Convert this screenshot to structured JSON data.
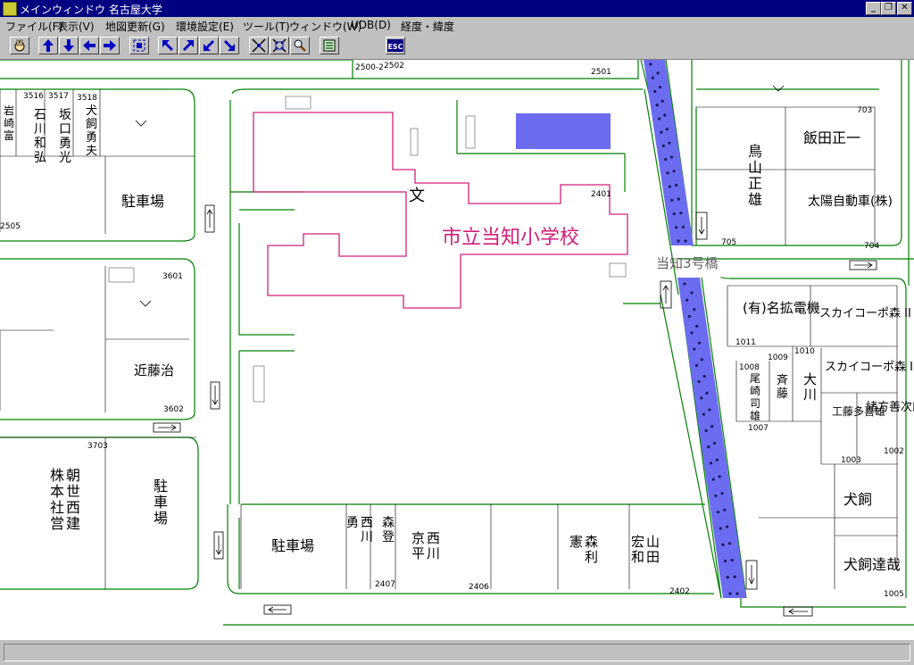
{
  "window": {
    "title": "メインウィンドウ 名古屋大学",
    "minimize": "_",
    "restore": "❐",
    "close": "✕"
  },
  "menu": [
    "ファイル(F)",
    "表示(V)",
    "地図更新(G)",
    "環境設定(E)",
    "ツール(T)",
    "ウィンドウ(W)",
    "UDB(D)",
    "経度・緯度"
  ],
  "toolbar": {
    "esc_label": "ESC",
    "icons": [
      "hand-icon",
      "arrow-up-icon",
      "arrow-down-icon",
      "arrow-left-icon",
      "arrow-right-icon",
      "fit-view-icon",
      "arrow-upleft-icon",
      "arrow-upright-icon",
      "arrow-downleft-icon",
      "arrow-downright-icon",
      "zoom-out-icon",
      "zoom-in-icon",
      "magnifier-icon",
      "layers-icon",
      "esc-icon"
    ]
  },
  "map": {
    "road_color": "#008000",
    "school_color": "#d0207a",
    "rail_color": "#6c6cf0",
    "school": {
      "name": "市立当知小学校",
      "symbol": "文",
      "lot": "2401"
    },
    "bridge": "当知3号橋",
    "lots": [
      "2500-2",
      "2502",
      "2501",
      "3516",
      "3517",
      "3518",
      "2505",
      "3601",
      "3602",
      "3703",
      "2407",
      "2406",
      "2402",
      "703",
      "704",
      "705",
      "1011",
      "1010",
      "1009",
      "1008",
      "1007",
      "1003",
      "1002",
      "1005"
    ],
    "labels": {
      "parking1": "駐車場",
      "parking2": "駐車場",
      "parking3": "駐車場",
      "kondo": "近藤治",
      "asahi": "朝世西建株本社営",
      "nishikawa_kyohei": "西川京平",
      "mori_toru": "森登",
      "nishikawa_isamu": "西川勇",
      "mori_toshinori": "森利憲",
      "yamada": "山田宏和",
      "toriyama": "鳥山正雄",
      "iida": "飯田正一",
      "taiyo": "太陽自動車(株)",
      "meikaku": "(有)名拡電機",
      "sky2": "スカイコーポ森 II",
      "sky1": "スカイコーポ森 I",
      "saito": "斉藤",
      "okawa": "大川",
      "omiya": "尾崎司雄",
      "kudo": "工藤多喜雄",
      "ogata": "緒方善次郎",
      "inukai": "犬飼",
      "inukai_tatsuya": "犬飼達哉",
      "iwata": "岩崎富",
      "ishikawa": "石川和弘",
      "sakaguchi": "坂口勇光",
      "inukai_yuu": "犬飼勇夫"
    }
  }
}
